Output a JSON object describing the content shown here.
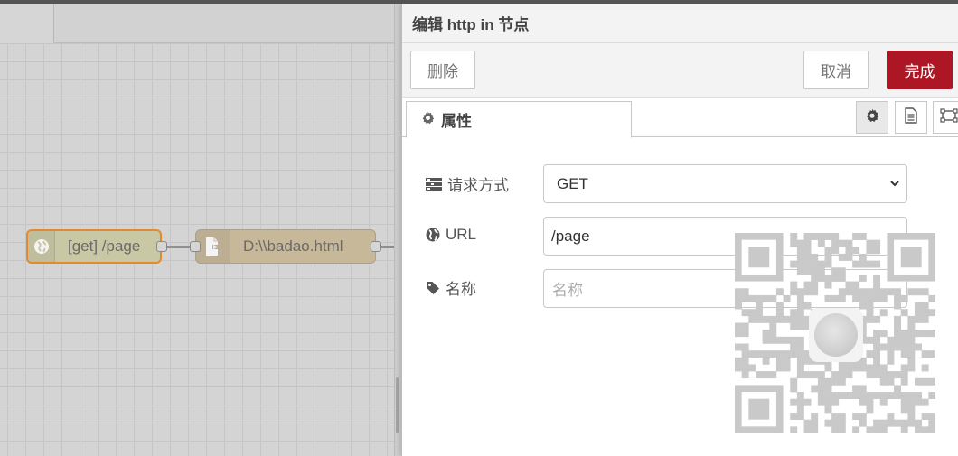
{
  "workspace": {
    "nodes": [
      {
        "label": "[get] /page",
        "icon": "globe-icon"
      },
      {
        "label": "D:\\\\badao.html",
        "icon": "file-out-icon"
      }
    ]
  },
  "tray": {
    "title": "编辑 http in 节点",
    "toolbar": {
      "delete_label": "删除",
      "cancel_label": "取消",
      "done_label": "完成"
    },
    "tabs": {
      "properties_label": "属性"
    },
    "form": {
      "method": {
        "label": "请求方式",
        "value": "GET"
      },
      "url": {
        "label": "URL",
        "value": "/page"
      },
      "name": {
        "label": "名称",
        "placeholder": "名称",
        "value": ""
      }
    }
  },
  "colors": {
    "done_button": "#ad1625",
    "selected_node_border": "#e08a32",
    "http_in_node": "#c9c8a5",
    "file_node": "#c7b89a"
  }
}
